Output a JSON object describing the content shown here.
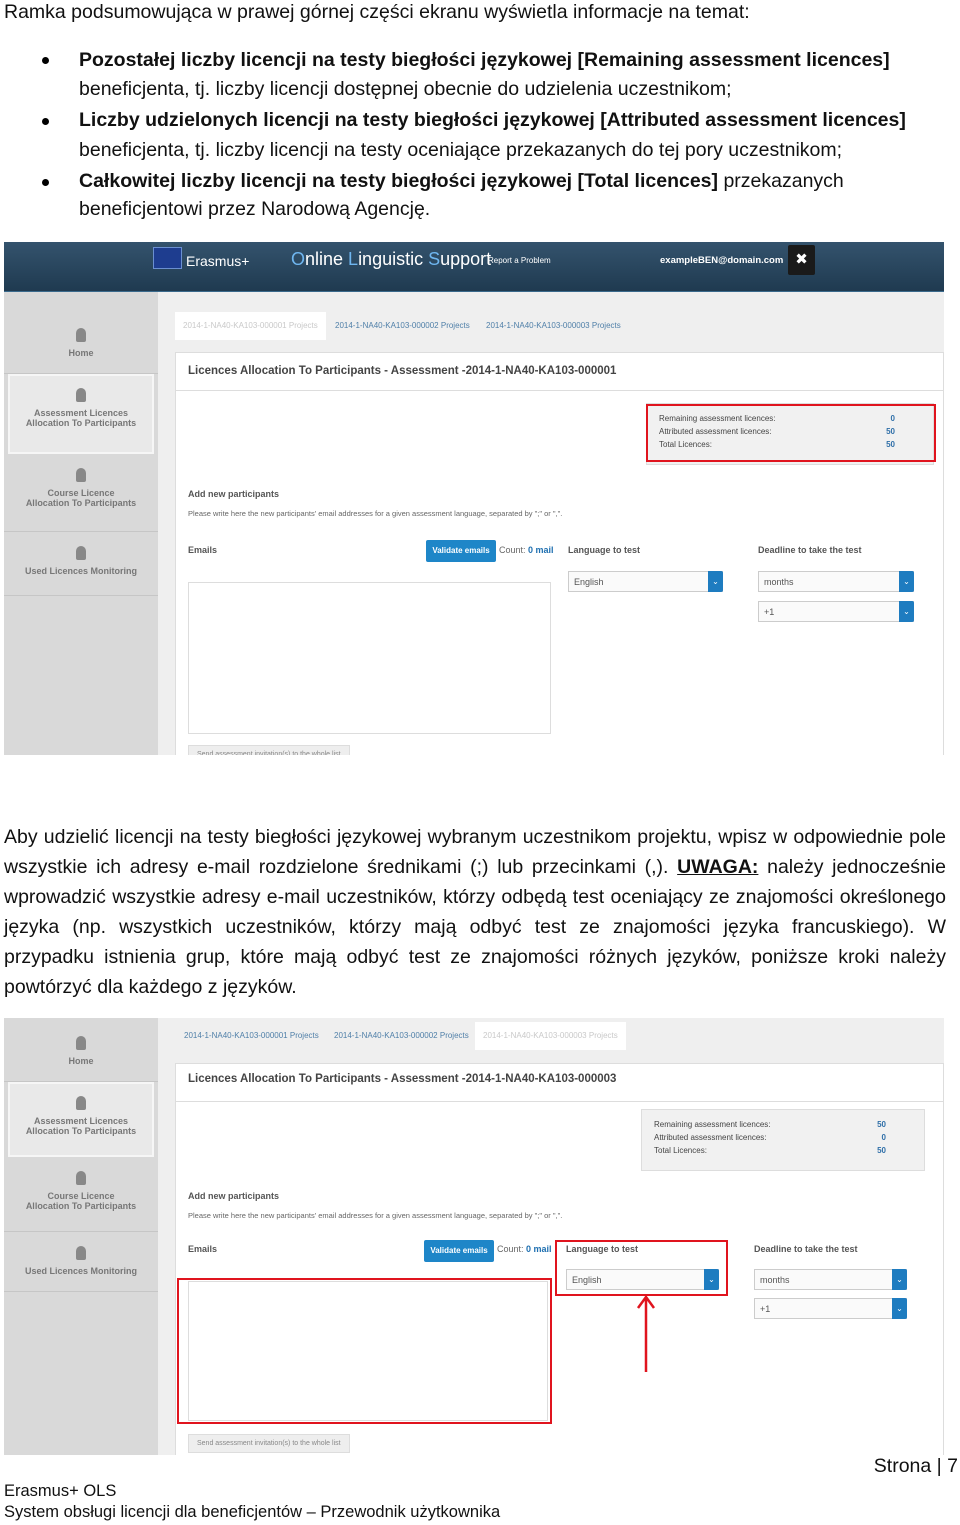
{
  "intro": "Ramka podsumowująca w prawej górnej części ekranu wyświetla informacje na temat:",
  "bullets": [
    {
      "bold": "Pozostałej liczby licencji na testy biegłości językowej [Remaining assessment licences]",
      "rest": "beneficjenta, tj. liczby licencji dostępnej obecnie do udzielenia uczestnikom;"
    },
    {
      "bold": "Liczby udzielonych licencji na testy biegłości językowej [Attributed assessment licences]",
      "rest": "beneficjenta, tj. liczby licencji na testy oceniające przekazanych do tej pory uczestnikom;"
    },
    {
      "bold": "Całkowitej liczby licencji na testy biegłości językowej [Total licences]",
      "tail": " przekazanych",
      "rest": "beneficjentowi przez Narodową Agencję."
    }
  ],
  "app": {
    "brand": "Erasmus+",
    "title_parts": [
      "O",
      "nline ",
      "L",
      "inguistic ",
      "S",
      "upport"
    ],
    "report": "Report a Problem",
    "email": "exampleBEN@domain.com",
    "close": "✖"
  },
  "sidebar": [
    "Home",
    "Assessment Licences",
    "Allocation To Participants",
    "Course Licence",
    "Allocation To Participants",
    "Used Licences Monitoring"
  ],
  "tabs": [
    "2014-1-NA40-KA103-000001 Projects",
    "2014-1-NA40-KA103-000002 Projects",
    "2014-1-NA40-KA103-000003 Projects"
  ],
  "shot1": {
    "title": "Licences Allocation To Participants - Assessment -2014-1-NA40-KA103-000001",
    "remaining": "0",
    "attributed": "50",
    "total": "50"
  },
  "shot2": {
    "title": "Licences Allocation To Participants - Assessment -2014-1-NA40-KA103-000003",
    "remaining": "50",
    "attributed": "0",
    "total": "50"
  },
  "form": {
    "remaining_label": "Remaining assessment licences:",
    "attributed_label": "Attributed assessment licences:",
    "total_label": "Total Licences:",
    "add": "Add new participants",
    "instructions": "Please write here the new participants' email addresses for a given assessment language, separated by \";\" or \",\".",
    "emails": "Emails",
    "validate": "Validate emails",
    "count": "Count:",
    "count_val": "0 mail",
    "language": "Language to test",
    "deadline": "Deadline to take the test",
    "lang_val": "English",
    "unit_val": "months",
    "num_val": "+1",
    "send": "Send assessment invitation(s) to the whole list"
  },
  "paragraph": {
    "before": "Aby udzielić licencji na testy biegłości językowej wybranym uczestnikom projektu, wpisz w odpowiednie pole wszystkie ich adresy e-mail rozdzielone średnikami (;) lub przecinkami (,). ",
    "warn": "UWAGA:",
    "after": " należy jednocześnie wprowadzić wszystkie adresy e-mail uczestników, którzy odbędą test oceniający ze znajomości określonego języka (np. wszystkich uczestników, którzy mają odbyć test ze znajomości języka francuskiego). W przypadku istnienia grup, które mają odbyć test ze znajomości różnych języków, poniższe kroki należy powtórzyć dla każdego z języków."
  },
  "footer": {
    "page": "Strona | 7",
    "line1": "Erasmus+ OLS",
    "line2": "System obsługi licencji dla beneficjentów – Przewodnik użytkownika"
  },
  "colors": {
    "highlight": "#e0141e",
    "accent": "#1e86c8",
    "header": "#1f3a50"
  }
}
